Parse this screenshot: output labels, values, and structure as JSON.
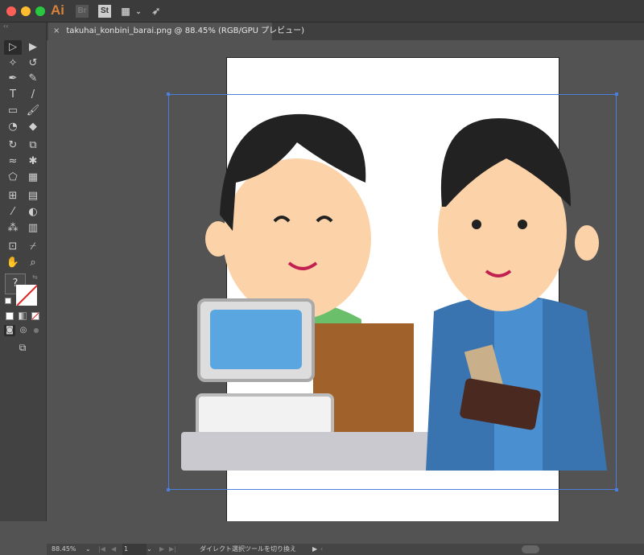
{
  "app": {
    "name": "Ai",
    "icon": "illustrator-logo"
  },
  "titlebar": {
    "icons": [
      "bridge-icon",
      "stock-icon",
      "workspace-layout-icon",
      "chevron-down-icon",
      "gpu-performance-rocket-icon"
    ],
    "bridge": "Br",
    "stock": "St"
  },
  "document_tab": {
    "close": "×",
    "title": "takuhai_konbini_barai.png @ 88.45% (RGB/GPU プレビュー)"
  },
  "tools": [
    [
      "selection",
      "▷"
    ],
    [
      "direct-selection",
      "▶"
    ],
    [
      "magic-wand",
      "✧"
    ],
    [
      "lasso",
      "↺"
    ],
    [
      "pen",
      "✒"
    ],
    [
      "curvature",
      "✎"
    ],
    [
      "type",
      "T"
    ],
    [
      "line-segment",
      "/"
    ],
    [
      "rectangle",
      "▭"
    ],
    [
      "paintbrush",
      "🖌"
    ],
    [
      "shaper",
      "◔"
    ],
    [
      "eraser",
      "◆"
    ],
    [
      "rotate",
      "↻"
    ],
    [
      "scale",
      "⧉"
    ],
    [
      "warp",
      "≈"
    ],
    [
      "puppet-warp",
      "✱"
    ],
    [
      "shape-builder",
      "⬠"
    ],
    [
      "perspective-grid",
      "▦"
    ],
    [
      "mesh",
      "⊞"
    ],
    [
      "gradient",
      "▤"
    ],
    [
      "eyedropper",
      "⁄"
    ],
    [
      "blend",
      "◐"
    ],
    [
      "symbol-sprayer",
      "⁂"
    ],
    [
      "column-graph",
      "▥"
    ],
    [
      "artboard",
      "⊡"
    ],
    [
      "slice",
      "⌿"
    ],
    [
      "hand",
      "✋"
    ],
    [
      "zoom",
      "⌕"
    ]
  ],
  "fill_stroke": {
    "fill_label": "?",
    "swap": "⇆"
  },
  "canvas": {
    "selection_color": "#4a7fe0"
  },
  "status": {
    "zoom": "88.45%",
    "artboard_number": "1",
    "tool_hint": "ダイレクト選択ツールを切り換え",
    "play": "▶",
    "back": "‹",
    "first": "|◀",
    "prev": "◀",
    "next": "▶",
    "last": "▶|",
    "dropdown": "⌄"
  }
}
